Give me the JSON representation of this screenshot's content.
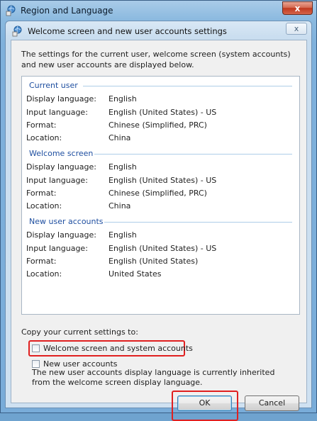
{
  "outer_window": {
    "title": "Region and Language",
    "close_label": "x"
  },
  "dialog": {
    "title": "Welcome screen and new user accounts settings",
    "close_label": "x",
    "intro": "The settings for the current user, welcome screen (system accounts) and new user accounts are displayed below.",
    "field_labels": {
      "display_language": "Display language:",
      "input_language": "Input language:",
      "format": "Format:",
      "location": "Location:"
    },
    "sections": [
      {
        "header": "Current user",
        "display_language": "English",
        "input_language": "English (United States) - US",
        "format": "Chinese (Simplified, PRC)",
        "location": "China"
      },
      {
        "header": "Welcome screen",
        "display_language": "English",
        "input_language": "English (United States) - US",
        "format": "Chinese (Simplified, PRC)",
        "location": "China"
      },
      {
        "header": "New user accounts",
        "display_language": "English",
        "input_language": "English (United States) - US",
        "format": "English (United States)",
        "location": "United States"
      }
    ],
    "copy_label": "Copy your current settings to:",
    "checkboxes": [
      {
        "label": "Welcome screen and system accounts",
        "checked": false
      },
      {
        "label": "New user accounts",
        "checked": false
      }
    ],
    "note": "The new user accounts display language is currently inherited from the welcome screen display language.",
    "buttons": {
      "ok": "OK",
      "cancel": "Cancel"
    }
  },
  "colors": {
    "highlight": "#e02020",
    "section_header": "#1f4fa0"
  }
}
